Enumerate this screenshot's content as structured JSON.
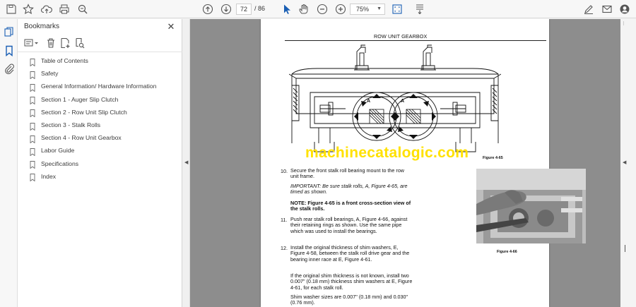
{
  "toolbar": {
    "current_page": "72",
    "total_pages": "/ 86",
    "zoom": "75%"
  },
  "bookmarks": {
    "title": "Bookmarks",
    "items": [
      {
        "label": "Table of Contents"
      },
      {
        "label": "Safety"
      },
      {
        "label": "General Information/ Hardware Information"
      },
      {
        "label": "Section 1 - Auger Slip Clutch"
      },
      {
        "label": "Section 2 - Row Unit Slip Clutch"
      },
      {
        "label": "Section 3 - Stalk Rolls"
      },
      {
        "label": "Section 4 - Row Unit Gearbox"
      },
      {
        "label": "Labor Guide"
      },
      {
        "label": "Specifications"
      },
      {
        "label": "Index"
      }
    ]
  },
  "document": {
    "header": "ROW UNIT GEARBOX",
    "figure_65": "Figure 4-65",
    "figure_66": "Figure 4-66",
    "diagram_label_a": "A",
    "watermark": "machinecatalogic.com",
    "step10_num": "10.",
    "step10_text": "Secure the front stalk roll bearing mount to the row unit frame.",
    "important": "IMPORTANT: Be sure stalk rolls, A, Figure 4-65, are timed as shown.",
    "note": "NOTE: Figure 4-65 is a front cross-section view of the stalk rolls.",
    "step11_num": "11.",
    "step11_text": "Push rear stalk roll bearings, A, Figure 4-66, against their retaining rings as shown. Use the same pipe which was used to install the bearings.",
    "step12_num": "12.",
    "step12_text": "Install the original thickness of shim washers, E, Figure 4-58, between the stalk roll drive gear and the bearing inner race at E, Figure 4-61.",
    "step12b_text": "If the original shim thickness is not known, install two 0.007\" (0.18 mm) thickness shim washers at E, Figure 4-61, for each stalk roll.",
    "step12c_text": "Shim washer sizes are 0.007\" (0.18 mm) and 0.030\" (0.76 mm)."
  },
  "colors": {
    "watermark": "#ffe100",
    "viewer_bg": "#8d8d8d",
    "accent_blue": "#1a5fb4"
  }
}
